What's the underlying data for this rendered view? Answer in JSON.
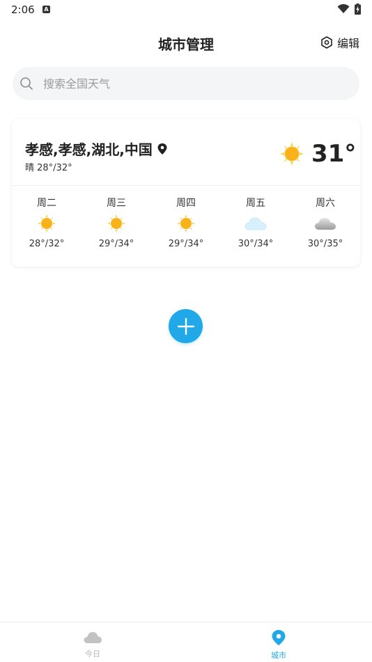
{
  "status": {
    "time": "2:06",
    "a_icon": "A"
  },
  "header": {
    "title": "城市管理",
    "edit_label": "编辑"
  },
  "search": {
    "placeholder": "搜索全国天气"
  },
  "city": {
    "name": "孝感,孝感,湖北,中国",
    "today": "晴 28°/32°",
    "current_temp": "31°",
    "current_icon": "sun-icon",
    "forecast": [
      {
        "day": "周二",
        "range": "28°/32°",
        "icon": "sun-icon"
      },
      {
        "day": "周三",
        "range": "29°/34°",
        "icon": "sun-icon"
      },
      {
        "day": "周四",
        "range": "29°/34°",
        "icon": "sun-icon"
      },
      {
        "day": "周五",
        "range": "30°/34°",
        "icon": "light-cloud-icon"
      },
      {
        "day": "周六",
        "range": "30°/35°",
        "icon": "cloud-icon"
      }
    ]
  },
  "nav": {
    "items": [
      {
        "label": "今日",
        "icon": "cloud-icon",
        "active": false
      },
      {
        "label": "城市",
        "icon": "location-pin-icon",
        "active": true
      }
    ]
  },
  "colors": {
    "accent": "#20a8e8",
    "nav_inactive": "#b5b5b5",
    "sun": "#f9b21a"
  }
}
